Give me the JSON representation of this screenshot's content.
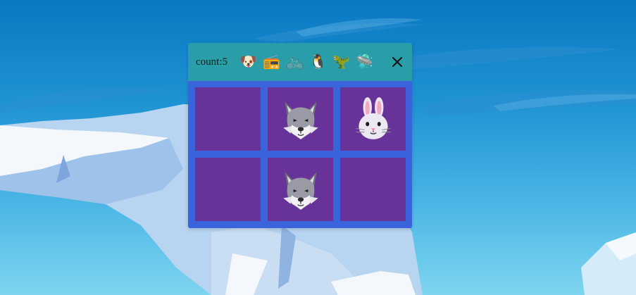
{
  "header": {
    "count_text": "count:5"
  },
  "toolbar": {
    "items": [
      {
        "name": "dog-face",
        "glyph": "🐶"
      },
      {
        "name": "radio",
        "glyph": "📻"
      },
      {
        "name": "bicycle",
        "glyph": "🚲"
      },
      {
        "name": "penguin",
        "glyph": "🐧"
      },
      {
        "name": "t-rex",
        "glyph": "🦖"
      },
      {
        "name": "flying-saucer",
        "glyph": "🛸"
      }
    ],
    "close_glyph": "✕"
  },
  "board": {
    "rows": 2,
    "cols": 3,
    "cells": [
      {
        "content": "empty"
      },
      {
        "content": "wolf"
      },
      {
        "content": "rabbit"
      },
      {
        "content": "empty"
      },
      {
        "content": "wolf"
      },
      {
        "content": "empty"
      }
    ]
  },
  "colors": {
    "header_bg": "#2a9ea8",
    "board_bg": "#3a63dc",
    "cell_bg": "#673399",
    "sky_top": "#0a78c2",
    "sky_bottom": "#7fd5ef"
  }
}
